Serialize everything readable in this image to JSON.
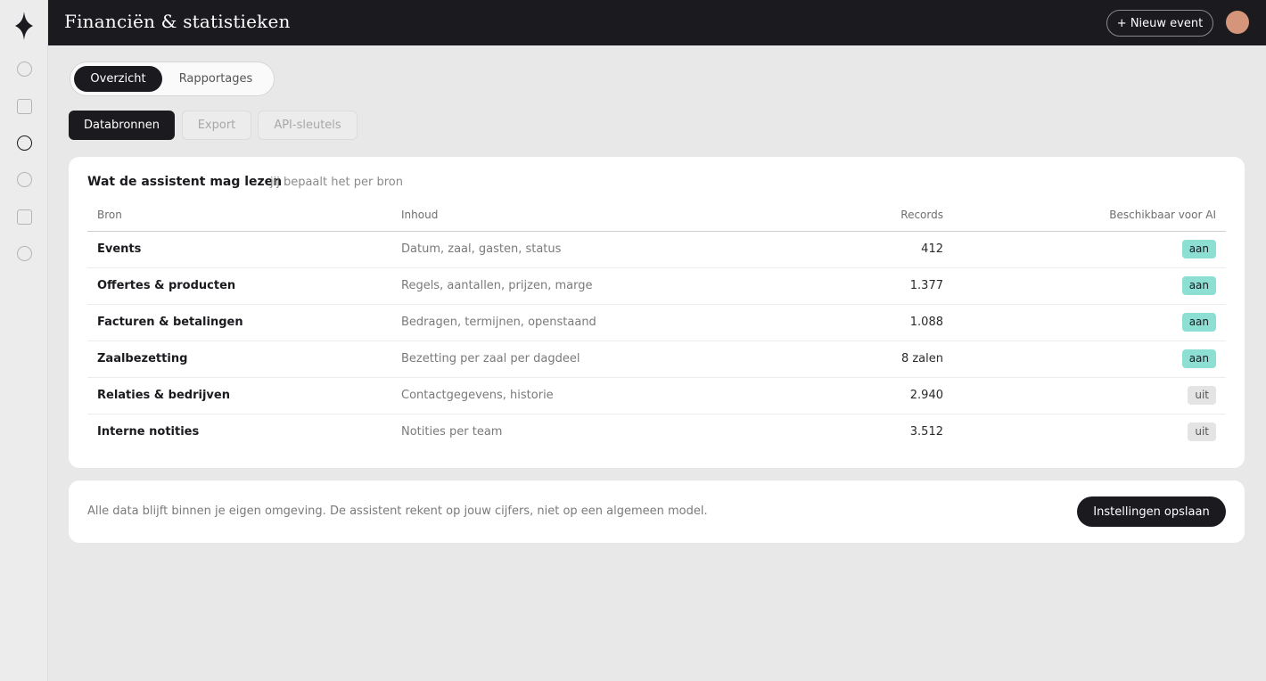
{
  "header": {
    "title": "Financiën & statistieken",
    "new_event_label": "+ Nieuw event"
  },
  "sidebar": {
    "items": [
      {
        "icon": "circle-icon",
        "active": false
      },
      {
        "icon": "square-icon",
        "active": false
      },
      {
        "icon": "circle-icon",
        "active": true
      },
      {
        "icon": "circle-icon",
        "active": false
      },
      {
        "icon": "square-icon",
        "active": false
      },
      {
        "icon": "circle-icon",
        "active": false
      }
    ]
  },
  "view_tabs": {
    "active": "Overzicht",
    "inactive": "Rapportages"
  },
  "sub_tabs": {
    "datasources": "Databronnen",
    "export": "Export",
    "api_keys": "API-sleutels"
  },
  "sources_card": {
    "title": "Wat de assistent mag lezen",
    "subtitle": "jij bepaalt het per bron",
    "columns": {
      "source": "Bron",
      "content": "Inhoud",
      "records": "Records",
      "available": "Beschikbaar voor AI"
    },
    "rows": [
      {
        "source": "Events",
        "content": "Datum, zaal, gasten, status",
        "records": "412",
        "available": "aan"
      },
      {
        "source": "Offertes & producten",
        "content": "Regels, aantallen, prijzen, marge",
        "records": "1.377",
        "available": "aan"
      },
      {
        "source": "Facturen & betalingen",
        "content": "Bedragen, termijnen, openstaand",
        "records": "1.088",
        "available": "aan"
      },
      {
        "source": "Zaalbezetting",
        "content": "Bezetting per zaal per dagdeel",
        "records": "8 zalen",
        "available": "aan"
      },
      {
        "source": "Relaties & bedrijven",
        "content": "Contactgegevens, historie",
        "records": "2.940",
        "available": "uit"
      },
      {
        "source": "Interne notities",
        "content": "Notities per team",
        "records": "3.512",
        "available": "uit"
      }
    ]
  },
  "footer": {
    "note": "Alle data blijft binnen je eigen omgeving. De assistent rekent op jouw cijfers, niet op een algemeen model.",
    "save_label": "Instellingen opslaan"
  },
  "colors": {
    "dark": "#1a1a1f",
    "on_badge": "#8ddfd4",
    "off_badge": "#e4e4e4",
    "avatar": "#d4957a",
    "background": "#e8e8e8"
  }
}
